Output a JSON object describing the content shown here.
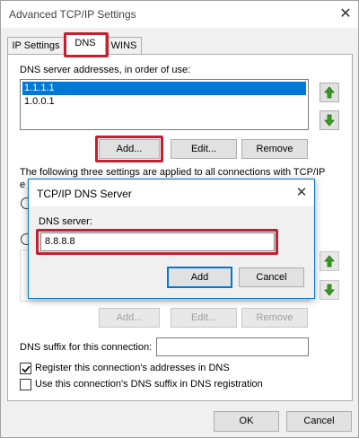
{
  "window": {
    "title": "Advanced TCP/IP Settings"
  },
  "tabs": [
    {
      "label": "IP Settings"
    },
    {
      "label": "DNS"
    },
    {
      "label": "WINS"
    }
  ],
  "dns_panel": {
    "servers_label": "DNS server addresses, in order of use:",
    "servers": [
      "1.1.1.1",
      "1.0.0.1"
    ],
    "add_label": "Add...",
    "edit_label": "Edit...",
    "remove_label": "Remove",
    "info_text_line1": "The following three settings are applied to all connections with TCP/IP",
    "info_text_line2": "e",
    "suffix_add_label": "Add...",
    "suffix_edit_label": "Edit...",
    "suffix_remove_label": "Remove",
    "dns_suffix_label": "DNS suffix for this connection:",
    "dns_suffix_value": "",
    "register_label": "Register this connection's addresses in DNS",
    "register_checked": true,
    "use_suffix_label": "Use this connection's DNS suffix in DNS registration",
    "use_suffix_checked": false
  },
  "footer": {
    "ok_label": "OK",
    "cancel_label": "Cancel"
  },
  "dialog": {
    "title": "TCP/IP DNS Server",
    "field_label": "DNS server:",
    "field_value": "8.8.8.8",
    "add_label": "Add",
    "cancel_label": "Cancel"
  },
  "colors": {
    "accent": "#0078d7",
    "highlight": "#c4202f",
    "arrow_green": "#3a9d23"
  }
}
